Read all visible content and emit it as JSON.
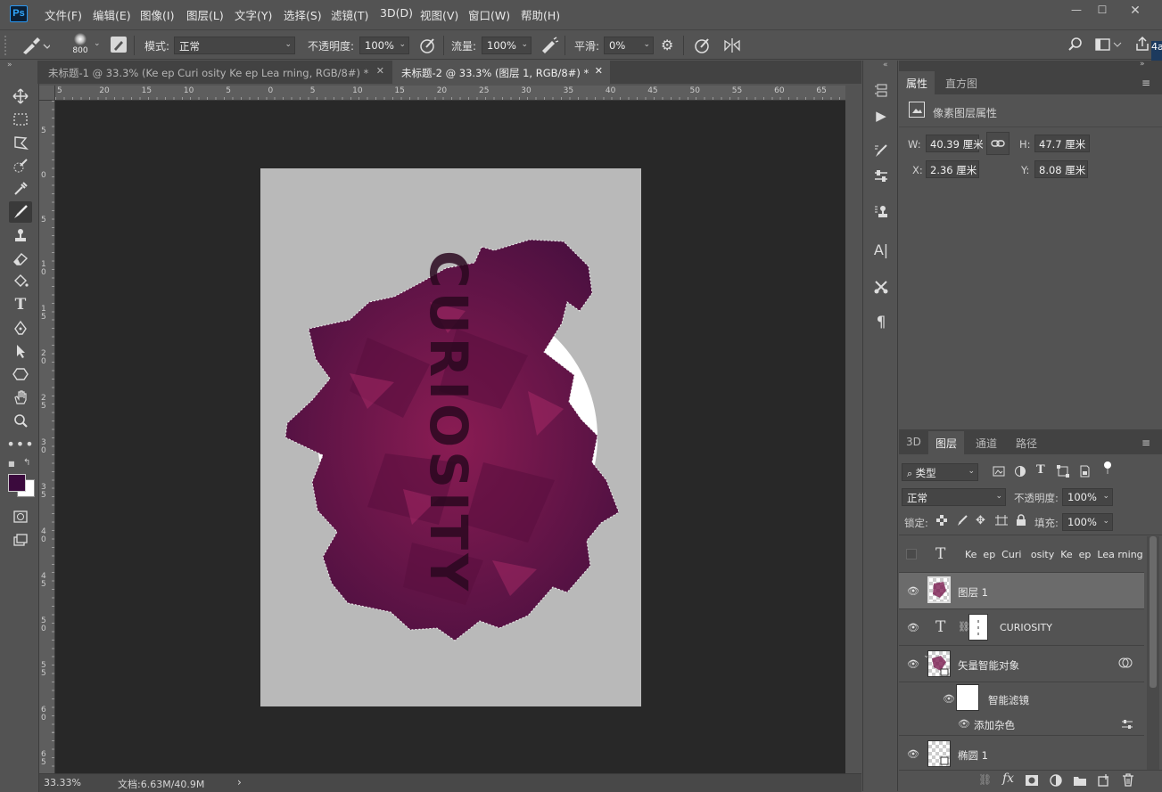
{
  "app": {
    "logo": "Ps"
  },
  "menu": [
    "文件(F)",
    "编辑(E)",
    "图像(I)",
    "图层(L)",
    "文字(Y)",
    "选择(S)",
    "滤镜(T)",
    "3D(D)",
    "视图(V)",
    "窗口(W)",
    "帮助(H)"
  ],
  "options": {
    "brush_size": "800",
    "mode_label": "模式:",
    "mode_value": "正常",
    "opacity_label": "不透明度:",
    "opacity_value": "100%",
    "flow_label": "流量:",
    "flow_value": "100%",
    "smooth_label": "平滑:",
    "smooth_value": "0%",
    "right_number": "4a"
  },
  "tabs": [
    {
      "label": "未标题-1 @ 33.3% (Ke  ep  Curi   osity  Ke  ep  Lea rning, RGB/8#) *",
      "active": false
    },
    {
      "label": "未标题-2 @ 33.3% (图层 1, RGB/8#) *",
      "active": true
    }
  ],
  "ruler": {
    "top": [
      "5",
      "20",
      "15",
      "10",
      "5",
      "0",
      "5",
      "10",
      "15",
      "20",
      "25",
      "30",
      "35",
      "40",
      "45",
      "50",
      "55",
      "60",
      "65"
    ],
    "left": [
      "5",
      "0",
      "5",
      "1 0",
      "1 5",
      "2 0",
      "2 5",
      "3 0",
      "3 5",
      "4 0",
      "4 5",
      "5 0",
      "5 5",
      "6 0",
      "6 5"
    ]
  },
  "canvas": {
    "text": "CURIOSITY",
    "page_color": "#b9b9b9",
    "accent": "#6e1742"
  },
  "toolbox": [
    "move-icon",
    "marquee-icon",
    "lasso-icon",
    "quick-select-icon",
    "eyedropper-icon",
    "brush-icon",
    "stamp-icon",
    "eraser-icon",
    "gradient-icon",
    "type-icon",
    "pen-icon",
    "path-select-icon",
    "shape-icon",
    "hand-icon",
    "zoom-icon",
    "more-icon"
  ],
  "colors": {
    "foreground": "#3b0a3d",
    "background": "#ffffff"
  },
  "status": {
    "zoom": "33.33%",
    "doc": "文档:6.63M/40.9M"
  },
  "properties": {
    "tabs": [
      "属性",
      "直方图"
    ],
    "header": "像素图层属性",
    "w_label": "W:",
    "w_value": "40.39 厘米",
    "h_label": "H:",
    "h_value": "47.7 厘米",
    "x_label": "X:",
    "x_value": "2.36 厘米",
    "y_label": "Y:",
    "y_value": "8.08 厘米"
  },
  "layers": {
    "tabs": [
      "3D",
      "图层",
      "通道",
      "路径"
    ],
    "filter_kind": "类型",
    "blend_mode": "正常",
    "opacity_label": "不透明度:",
    "opacity_value": "100%",
    "lock_label": "锁定:",
    "fill_label": "填充:",
    "fill_value": "100%",
    "items": [
      {
        "name": "Ke  ep  Curi   osity  Ke  ep  Lea rning",
        "visible": false,
        "kind": "text"
      },
      {
        "name": "图层 1",
        "visible": true,
        "kind": "pixel",
        "selected": true
      },
      {
        "name": "CURIOSITY",
        "visible": true,
        "kind": "text-masked"
      },
      {
        "name": "矢量智能对象",
        "visible": true,
        "kind": "smart"
      },
      {
        "name": "智能滤镜",
        "visible": true,
        "kind": "filter-group"
      },
      {
        "name": "添加杂色",
        "visible": true,
        "kind": "filter"
      },
      {
        "name": "椭圆 1",
        "visible": true,
        "kind": "shape"
      }
    ]
  }
}
